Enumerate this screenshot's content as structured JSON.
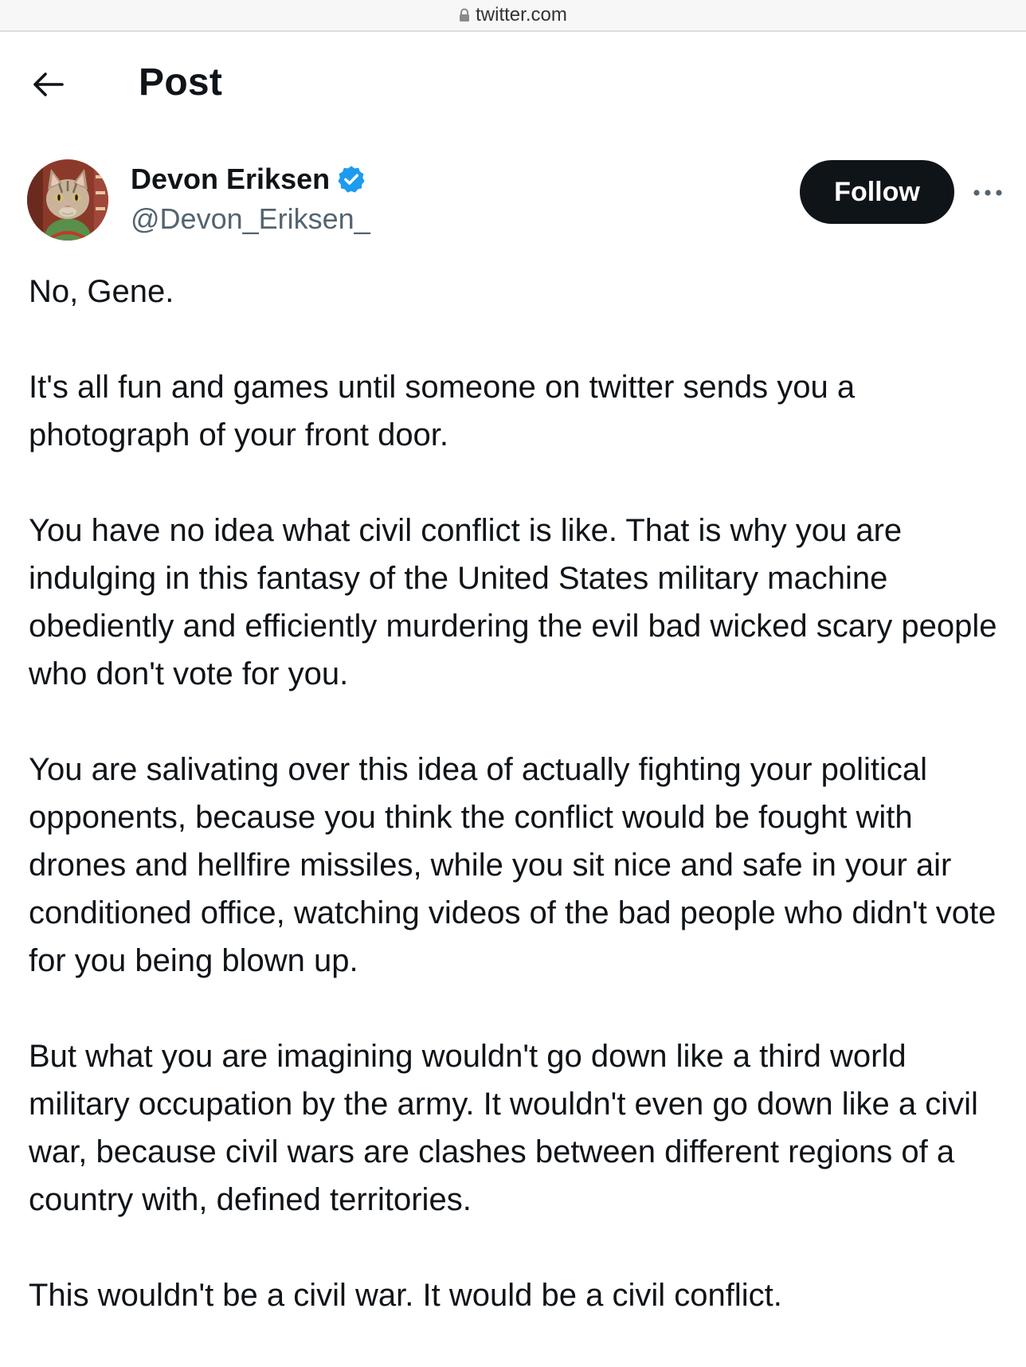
{
  "browser": {
    "url": "twitter.com",
    "lock_icon": "lock-icon"
  },
  "header": {
    "back_icon": "arrow-left-icon",
    "title": "Post"
  },
  "author": {
    "name": "Devon Eriksen",
    "handle": "@Devon_Eriksen_",
    "verified": true,
    "verified_color": "#1d9bf0",
    "avatar": "cat-avatar"
  },
  "actions": {
    "follow_label": "Follow",
    "more_icon": "more-horizontal-icon"
  },
  "tweet": {
    "paragraphs": [
      "No, Gene.",
      "It's all fun and games until someone on twitter sends you a photograph of your front door.",
      "You have no idea what civil conflict is like. That is why you are indulging in this fantasy of the United States military machine obediently and efficiently murdering the evil bad wicked scary people who don't vote for you.",
      "You are salivating over this idea of actually fighting your political opponents, because you think the conflict would be fought with drones and hellfire missiles, while you sit nice and safe in your air conditioned office, watching videos of the bad people who didn't vote for you being blown up.",
      "But what you are imagining wouldn't go down like a third world military occupation by the army. It wouldn't even go down like a civil war, because civil wars are clashes between different regions of a country with, defined territories.",
      "This wouldn't be a civil war. It would be a civil conflict."
    ]
  },
  "colors": {
    "text": "#0f1419",
    "secondary": "#536471",
    "follow_bg": "#0f1419",
    "verified": "#1d9bf0"
  }
}
